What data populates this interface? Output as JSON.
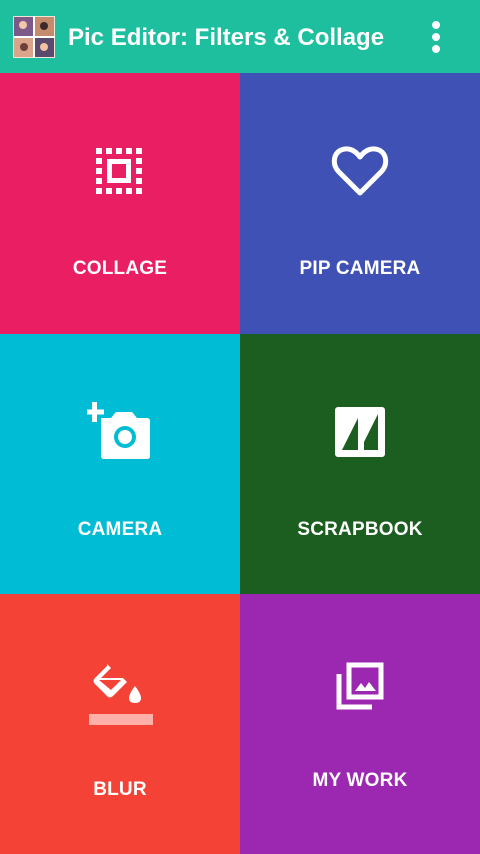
{
  "app_bar": {
    "title": "Pic Editor: Filters & Collage",
    "color": "#1dbf9f",
    "logo_icon": "app-logo-photo-icon",
    "menu_icon": "overflow-menu-icon"
  },
  "tiles": [
    {
      "label": "COLLAGE",
      "icon": "collage-frame-icon",
      "color": "#e91e63"
    },
    {
      "label": "PIP CAMERA",
      "icon": "heart-outline-icon",
      "color": "#3f51b5"
    },
    {
      "label": "CAMERA",
      "icon": "add-camera-icon",
      "color": "#00bcd4"
    },
    {
      "label": "SCRAPBOOK",
      "icon": "scrapbook-icon",
      "color": "#1b5e20"
    },
    {
      "label": "BLUR",
      "icon": "paint-bucket-icon",
      "color": "#f44336"
    },
    {
      "label": "MY WORK",
      "icon": "photo-library-icon",
      "color": "#9c27b0"
    }
  ]
}
